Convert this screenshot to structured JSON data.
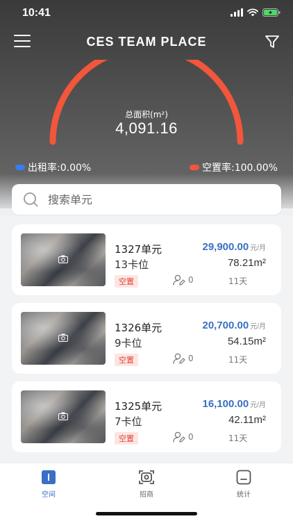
{
  "status": {
    "time": "10:41"
  },
  "nav": {
    "title": "CES TEAM PLACE"
  },
  "summary": {
    "area_label": "总面积(m²)",
    "area_value": "4,091.16",
    "rent_rate_label": "出租率:0.00%",
    "vacancy_rate_label": "空置率:100.00%",
    "rent_rate": 0.0,
    "vacancy_rate": 100.0
  },
  "search": {
    "placeholder": "搜索单元"
  },
  "units": [
    {
      "name": "1327单元",
      "price": "29,900.00",
      "price_unit": "元/月",
      "seats": "13卡位",
      "area": "78.21m²",
      "status": "空置",
      "visitors": "0",
      "days": "11天"
    },
    {
      "name": "1326单元",
      "price": "20,700.00",
      "price_unit": "元/月",
      "seats": "9卡位",
      "area": "54.15m²",
      "status": "空置",
      "visitors": "0",
      "days": "11天"
    },
    {
      "name": "1325单元",
      "price": "16,100.00",
      "price_unit": "元/月",
      "seats": "7卡位",
      "area": "42.11m²",
      "status": "空置",
      "visitors": "0",
      "days": "11天"
    }
  ],
  "tabs": [
    {
      "label": "空间",
      "active": true
    },
    {
      "label": "招商",
      "active": false
    },
    {
      "label": "统计",
      "active": false
    }
  ],
  "colors": {
    "accent": "#3a6fc4",
    "gauge": "#f2563b",
    "rent_dot": "#3a7bf0",
    "vacancy_dot": "#f2563b",
    "badge_text": "#e0463a"
  }
}
